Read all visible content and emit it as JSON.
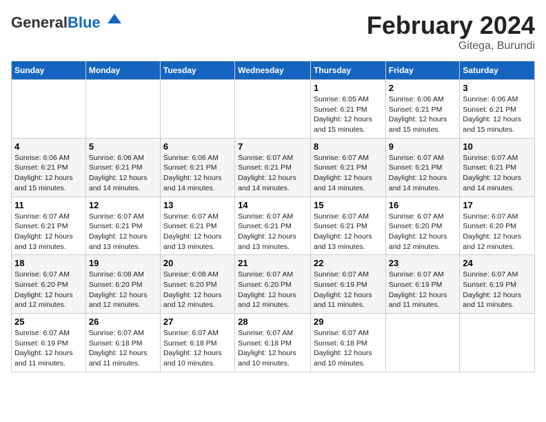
{
  "header": {
    "logo_general": "General",
    "logo_blue": "Blue",
    "month_title": "February 2024",
    "location": "Gitega, Burundi"
  },
  "weekdays": [
    "Sunday",
    "Monday",
    "Tuesday",
    "Wednesday",
    "Thursday",
    "Friday",
    "Saturday"
  ],
  "weeks": [
    [
      {
        "day": "",
        "info": ""
      },
      {
        "day": "",
        "info": ""
      },
      {
        "day": "",
        "info": ""
      },
      {
        "day": "",
        "info": ""
      },
      {
        "day": "1",
        "info": "Sunrise: 6:05 AM\nSunset: 6:21 PM\nDaylight: 12 hours\nand 15 minutes."
      },
      {
        "day": "2",
        "info": "Sunrise: 6:06 AM\nSunset: 6:21 PM\nDaylight: 12 hours\nand 15 minutes."
      },
      {
        "day": "3",
        "info": "Sunrise: 6:06 AM\nSunset: 6:21 PM\nDaylight: 12 hours\nand 15 minutes."
      }
    ],
    [
      {
        "day": "4",
        "info": "Sunrise: 6:06 AM\nSunset: 6:21 PM\nDaylight: 12 hours\nand 15 minutes."
      },
      {
        "day": "5",
        "info": "Sunrise: 6:06 AM\nSunset: 6:21 PM\nDaylight: 12 hours\nand 14 minutes."
      },
      {
        "day": "6",
        "info": "Sunrise: 6:06 AM\nSunset: 6:21 PM\nDaylight: 12 hours\nand 14 minutes."
      },
      {
        "day": "7",
        "info": "Sunrise: 6:07 AM\nSunset: 6:21 PM\nDaylight: 12 hours\nand 14 minutes."
      },
      {
        "day": "8",
        "info": "Sunrise: 6:07 AM\nSunset: 6:21 PM\nDaylight: 12 hours\nand 14 minutes."
      },
      {
        "day": "9",
        "info": "Sunrise: 6:07 AM\nSunset: 6:21 PM\nDaylight: 12 hours\nand 14 minutes."
      },
      {
        "day": "10",
        "info": "Sunrise: 6:07 AM\nSunset: 6:21 PM\nDaylight: 12 hours\nand 14 minutes."
      }
    ],
    [
      {
        "day": "11",
        "info": "Sunrise: 6:07 AM\nSunset: 6:21 PM\nDaylight: 12 hours\nand 13 minutes."
      },
      {
        "day": "12",
        "info": "Sunrise: 6:07 AM\nSunset: 6:21 PM\nDaylight: 12 hours\nand 13 minutes."
      },
      {
        "day": "13",
        "info": "Sunrise: 6:07 AM\nSunset: 6:21 PM\nDaylight: 12 hours\nand 13 minutes."
      },
      {
        "day": "14",
        "info": "Sunrise: 6:07 AM\nSunset: 6:21 PM\nDaylight: 12 hours\nand 13 minutes."
      },
      {
        "day": "15",
        "info": "Sunrise: 6:07 AM\nSunset: 6:21 PM\nDaylight: 12 hours\nand 13 minutes."
      },
      {
        "day": "16",
        "info": "Sunrise: 6:07 AM\nSunset: 6:20 PM\nDaylight: 12 hours\nand 12 minutes."
      },
      {
        "day": "17",
        "info": "Sunrise: 6:07 AM\nSunset: 6:20 PM\nDaylight: 12 hours\nand 12 minutes."
      }
    ],
    [
      {
        "day": "18",
        "info": "Sunrise: 6:07 AM\nSunset: 6:20 PM\nDaylight: 12 hours\nand 12 minutes."
      },
      {
        "day": "19",
        "info": "Sunrise: 6:08 AM\nSunset: 6:20 PM\nDaylight: 12 hours\nand 12 minutes."
      },
      {
        "day": "20",
        "info": "Sunrise: 6:08 AM\nSunset: 6:20 PM\nDaylight: 12 hours\nand 12 minutes."
      },
      {
        "day": "21",
        "info": "Sunrise: 6:07 AM\nSunset: 6:20 PM\nDaylight: 12 hours\nand 12 minutes."
      },
      {
        "day": "22",
        "info": "Sunrise: 6:07 AM\nSunset: 6:19 PM\nDaylight: 12 hours\nand 11 minutes."
      },
      {
        "day": "23",
        "info": "Sunrise: 6:07 AM\nSunset: 6:19 PM\nDaylight: 12 hours\nand 11 minutes."
      },
      {
        "day": "24",
        "info": "Sunrise: 6:07 AM\nSunset: 6:19 PM\nDaylight: 12 hours\nand 11 minutes."
      }
    ],
    [
      {
        "day": "25",
        "info": "Sunrise: 6:07 AM\nSunset: 6:19 PM\nDaylight: 12 hours\nand 11 minutes."
      },
      {
        "day": "26",
        "info": "Sunrise: 6:07 AM\nSunset: 6:18 PM\nDaylight: 12 hours\nand 11 minutes."
      },
      {
        "day": "27",
        "info": "Sunrise: 6:07 AM\nSunset: 6:18 PM\nDaylight: 12 hours\nand 10 minutes."
      },
      {
        "day": "28",
        "info": "Sunrise: 6:07 AM\nSunset: 6:18 PM\nDaylight: 12 hours\nand 10 minutes."
      },
      {
        "day": "29",
        "info": "Sunrise: 6:07 AM\nSunset: 6:18 PM\nDaylight: 12 hours\nand 10 minutes."
      },
      {
        "day": "",
        "info": ""
      },
      {
        "day": "",
        "info": ""
      }
    ]
  ]
}
